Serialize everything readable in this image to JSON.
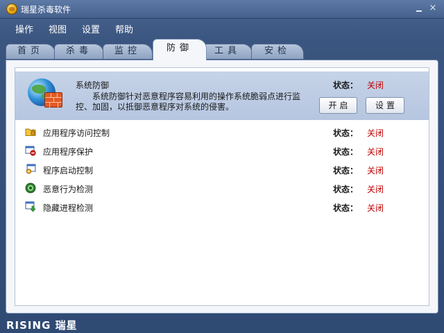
{
  "window": {
    "title": "瑞星杀毒软件",
    "minimize_glyph": "_",
    "close_glyph": "×"
  },
  "menu": [
    "操作",
    "视图",
    "设置",
    "帮助"
  ],
  "tabs": [
    {
      "label": "首页",
      "active": false
    },
    {
      "label": "杀毒",
      "active": false
    },
    {
      "label": "监控",
      "active": false
    },
    {
      "label": "防御",
      "active": true
    },
    {
      "label": "工具",
      "active": false
    },
    {
      "label": "安检",
      "active": false
    }
  ],
  "feature": {
    "title": "系统防御",
    "description": "系统防御针对恶意程序容易利用的操作系统脆弱点进行监控、加固，以抵御恶意程序对系统的侵害。",
    "status_label": "状态：",
    "status_value": "关闭",
    "enable_button": "开启",
    "settings_button": "设置",
    "icon": "globe-firewall-icon"
  },
  "items": [
    {
      "label": "应用程序访问控制",
      "status_label": "状态：",
      "status_value": "关闭",
      "icon": "folder-lock-icon"
    },
    {
      "label": "应用程序保护",
      "status_label": "状态：",
      "status_value": "关闭",
      "icon": "window-block-icon"
    },
    {
      "label": "程序启动控制",
      "status_label": "状态：",
      "status_value": "关闭",
      "icon": "window-gear-icon"
    },
    {
      "label": "恶意行为检测",
      "status_label": "状态：",
      "status_value": "关闭",
      "icon": "green-orb-icon"
    },
    {
      "label": "隐藏进程检测",
      "status_label": "状态：",
      "status_value": "关闭",
      "icon": "window-download-icon"
    }
  ],
  "footer": {
    "brand": "RISING 瑞星"
  },
  "colors": {
    "status_off": "#c00000",
    "accent": "#3a557f"
  }
}
